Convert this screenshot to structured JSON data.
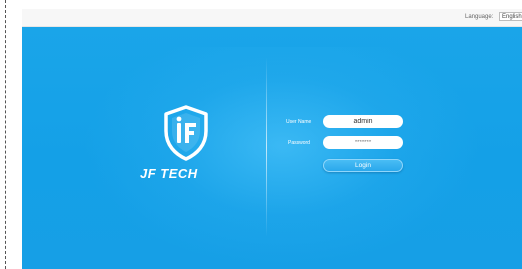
{
  "header": {
    "language_label": "Language:",
    "language_selected": "English"
  },
  "brand": {
    "name": "JF TECH"
  },
  "login": {
    "username_label": "User Name",
    "username_value": "admin",
    "password_label": "Password",
    "password_value": "*******",
    "login_button": "Login"
  }
}
